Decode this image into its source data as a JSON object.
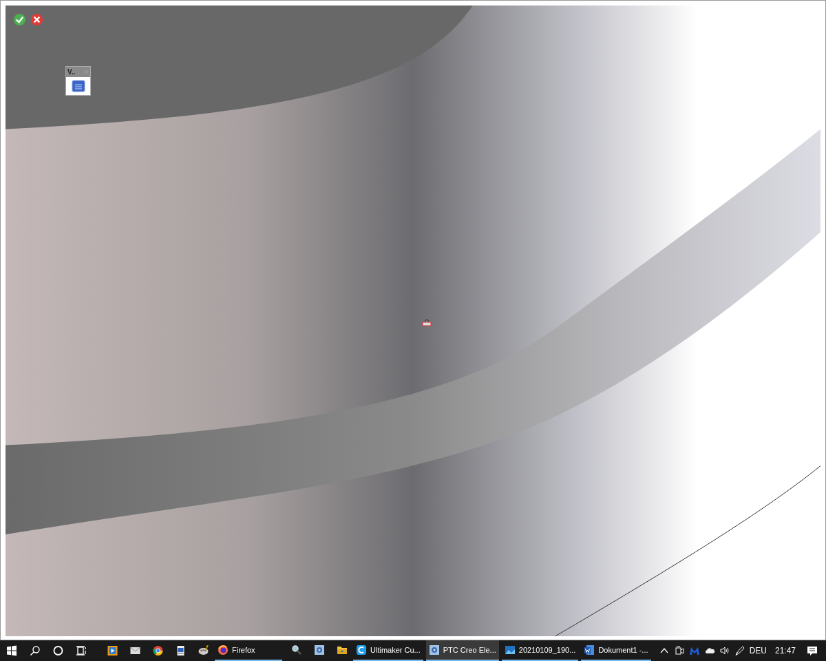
{
  "mini_toolbar": {
    "title": "V.."
  },
  "taskbar": {
    "buttons": [
      {
        "kind": "firefox",
        "label": "Firefox",
        "open": true,
        "selected": false
      },
      {
        "kind": "magnifier",
        "open": false,
        "selected": false
      },
      {
        "kind": "cad",
        "open": false,
        "selected": false
      },
      {
        "kind": "folder",
        "open": false,
        "selected": false
      },
      {
        "kind": "cura",
        "label": "Ultimaker Cu...",
        "open": true,
        "selected": false
      },
      {
        "kind": "cad",
        "label": "PTC Creo Ele...",
        "open": true,
        "selected": true
      },
      {
        "kind": "photo",
        "label": "20210109_190...",
        "open": true,
        "selected": false
      },
      {
        "kind": "word",
        "label": "Dokument1 -...",
        "open": true,
        "selected": false
      }
    ],
    "tray": {
      "language": "DEU",
      "time": "21:47"
    }
  }
}
